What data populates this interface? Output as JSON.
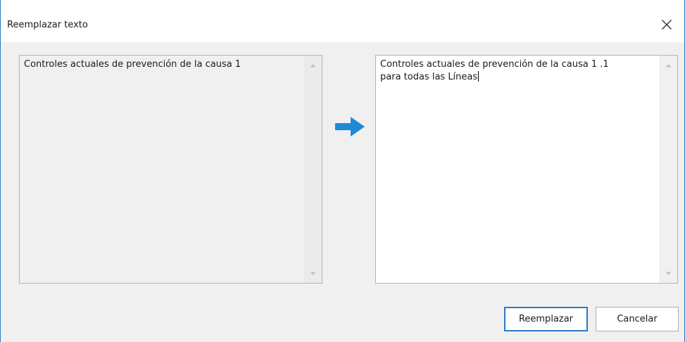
{
  "dialog": {
    "title": "Reemplazar texto",
    "close_icon": "close-icon"
  },
  "source": {
    "text": "Controles actuales de prevención de la causa 1",
    "read_only": true
  },
  "target": {
    "text": "Controles actuales de prevención de la causa 1 .1\npara todas las Líneas"
  },
  "arrow": {
    "icon": "arrow-right-icon",
    "color": "#1e8ad6"
  },
  "buttons": {
    "replace_label": "Reemplazar",
    "cancel_label": "Cancelar"
  },
  "colors": {
    "accent": "#2b79c2",
    "dialog_bg": "#f0f0f0"
  }
}
